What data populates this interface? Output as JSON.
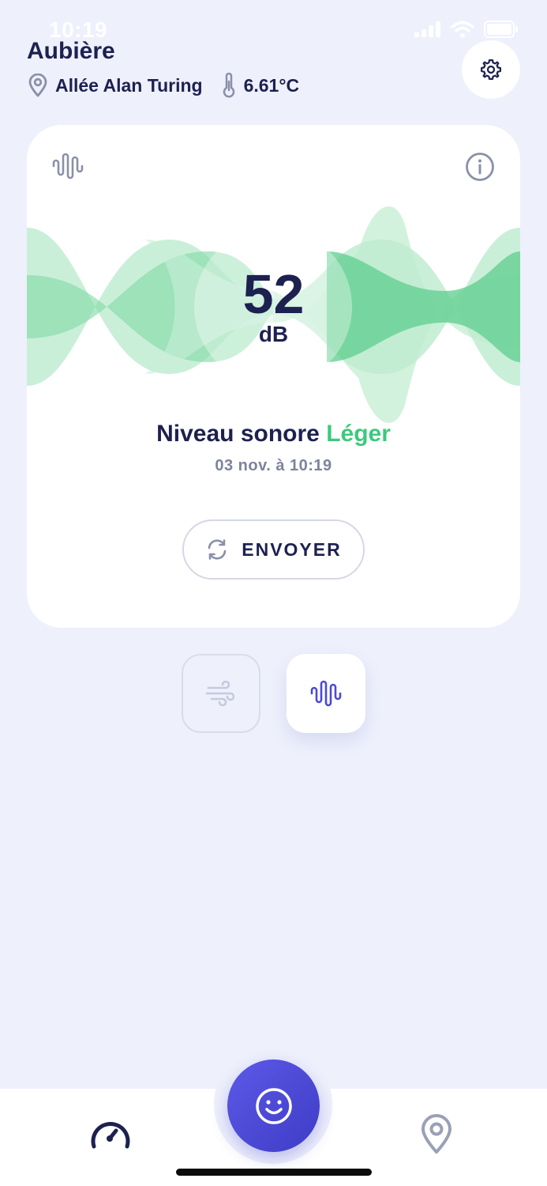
{
  "status_bar": {
    "time": "10:19"
  },
  "header": {
    "city": "Aubière",
    "street": "Allée Alan Turing",
    "temperature": "6.61°C"
  },
  "card": {
    "reading_value": "52",
    "reading_unit": "dB",
    "level_prefix": "Niveau sonore",
    "level_value": "Léger",
    "timestamp": "03 nov. à 10:19",
    "send_label": "ENVOYER"
  },
  "icons": {
    "settings": "gear-icon",
    "location": "map-pin-icon",
    "temperature": "thermometer-icon",
    "sound": "sound-wave-icon",
    "info": "info-icon",
    "send": "refresh-icon",
    "wind": "wind-icon",
    "fab": "smiley-icon",
    "nav_left": "gauge-icon",
    "nav_right": "map-pin-icon"
  },
  "colors": {
    "accent": "#4b49d6",
    "navy": "#1d2150",
    "green": "#3dc97d",
    "background": "#eef0fc"
  },
  "modes": {
    "active": "sound"
  }
}
